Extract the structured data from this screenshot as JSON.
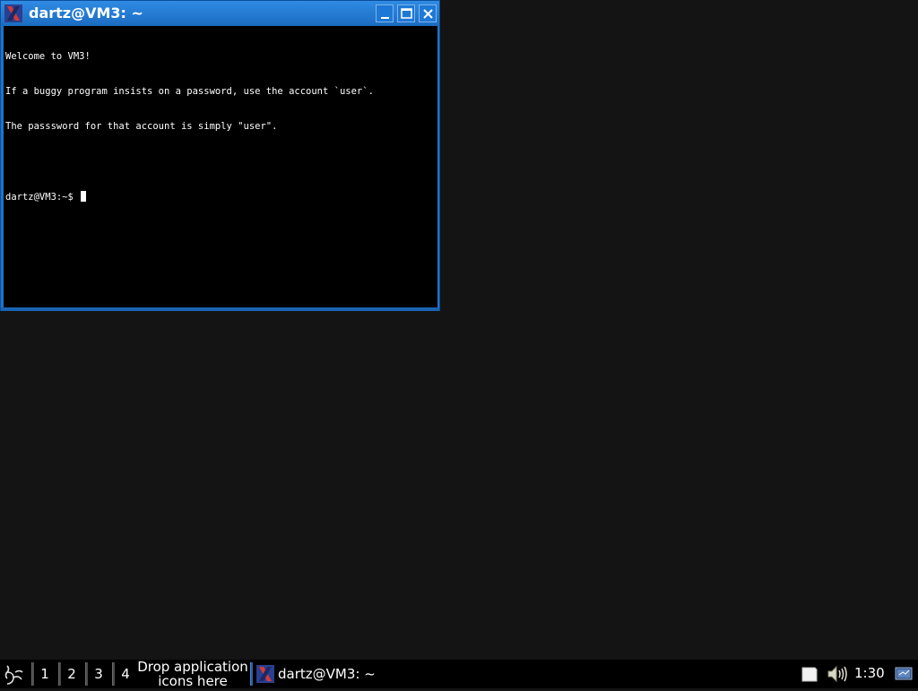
{
  "window": {
    "title": "dartz@VM3: ~",
    "icon": "x-terminal-icon",
    "buttons": {
      "minimize": "minimize-icon",
      "maximize": "maximize-icon",
      "close": "close-icon"
    }
  },
  "terminal": {
    "lines": [
      "Welcome to VM3!",
      "If a buggy program insists on a password, use the account `user`.",
      "The passsword for that account is simply \"user\".",
      "",
      "dartz@VM3:~$ "
    ]
  },
  "taskbar": {
    "start_icon": "start-menu-icon",
    "desktops": [
      "1",
      "2",
      "3",
      "4"
    ],
    "launcher_hint_line1": "Drop application",
    "launcher_hint_line2": "icons here",
    "tasks": [
      {
        "label": "dartz@VM3: ~",
        "icon": "x-terminal-icon"
      }
    ],
    "tray": {
      "file_icon": "file-icon",
      "volume_icon": "volume-icon",
      "network_icon": "network-icon"
    },
    "clock": "1:30"
  },
  "colors": {
    "desktop_bg": "#141414",
    "title_bar": "#1f72c8",
    "terminal_bg": "#000000",
    "taskbar_bg": "#000000"
  }
}
